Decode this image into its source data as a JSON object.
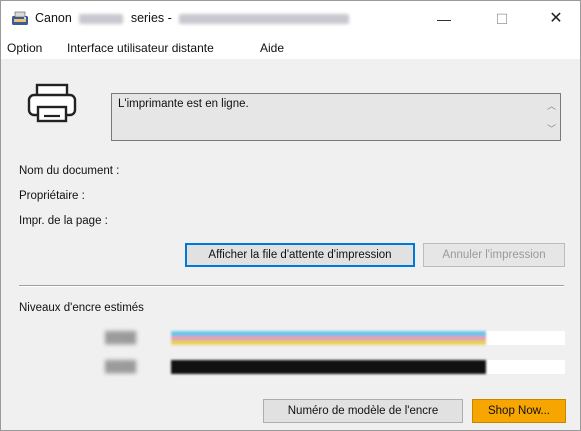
{
  "window": {
    "title_brand": "Canon",
    "title_series": "series -",
    "minimize_glyph": "—",
    "maximize_glyph": "☐",
    "close_glyph": "✕"
  },
  "menu": {
    "items": [
      "Option",
      "Interface utilisateur distante",
      "Aide"
    ]
  },
  "status": {
    "message": "L'imprimante est en ligne.",
    "scroll_up_glyph": "︿",
    "scroll_down_glyph": "﹀"
  },
  "details": {
    "document_label": "Nom du document :",
    "owner_label": "Propriétaire :",
    "page_label": "Impr. de la page :"
  },
  "buttons": {
    "show_queue": "Afficher la file d'attente d'impression",
    "cancel_print": "Annuler l'impression",
    "ink_model": "Numéro de modèle de l'encre",
    "shop_now": "Shop Now..."
  },
  "ink": {
    "heading": "Niveaux d'encre estimés",
    "colors": {
      "cyan": "#6ec6ea",
      "magenta": "#e8a0b8",
      "yellow": "#e6d25a",
      "black": "#111111"
    },
    "levels": {
      "color": 0.8,
      "black": 0.8
    }
  }
}
